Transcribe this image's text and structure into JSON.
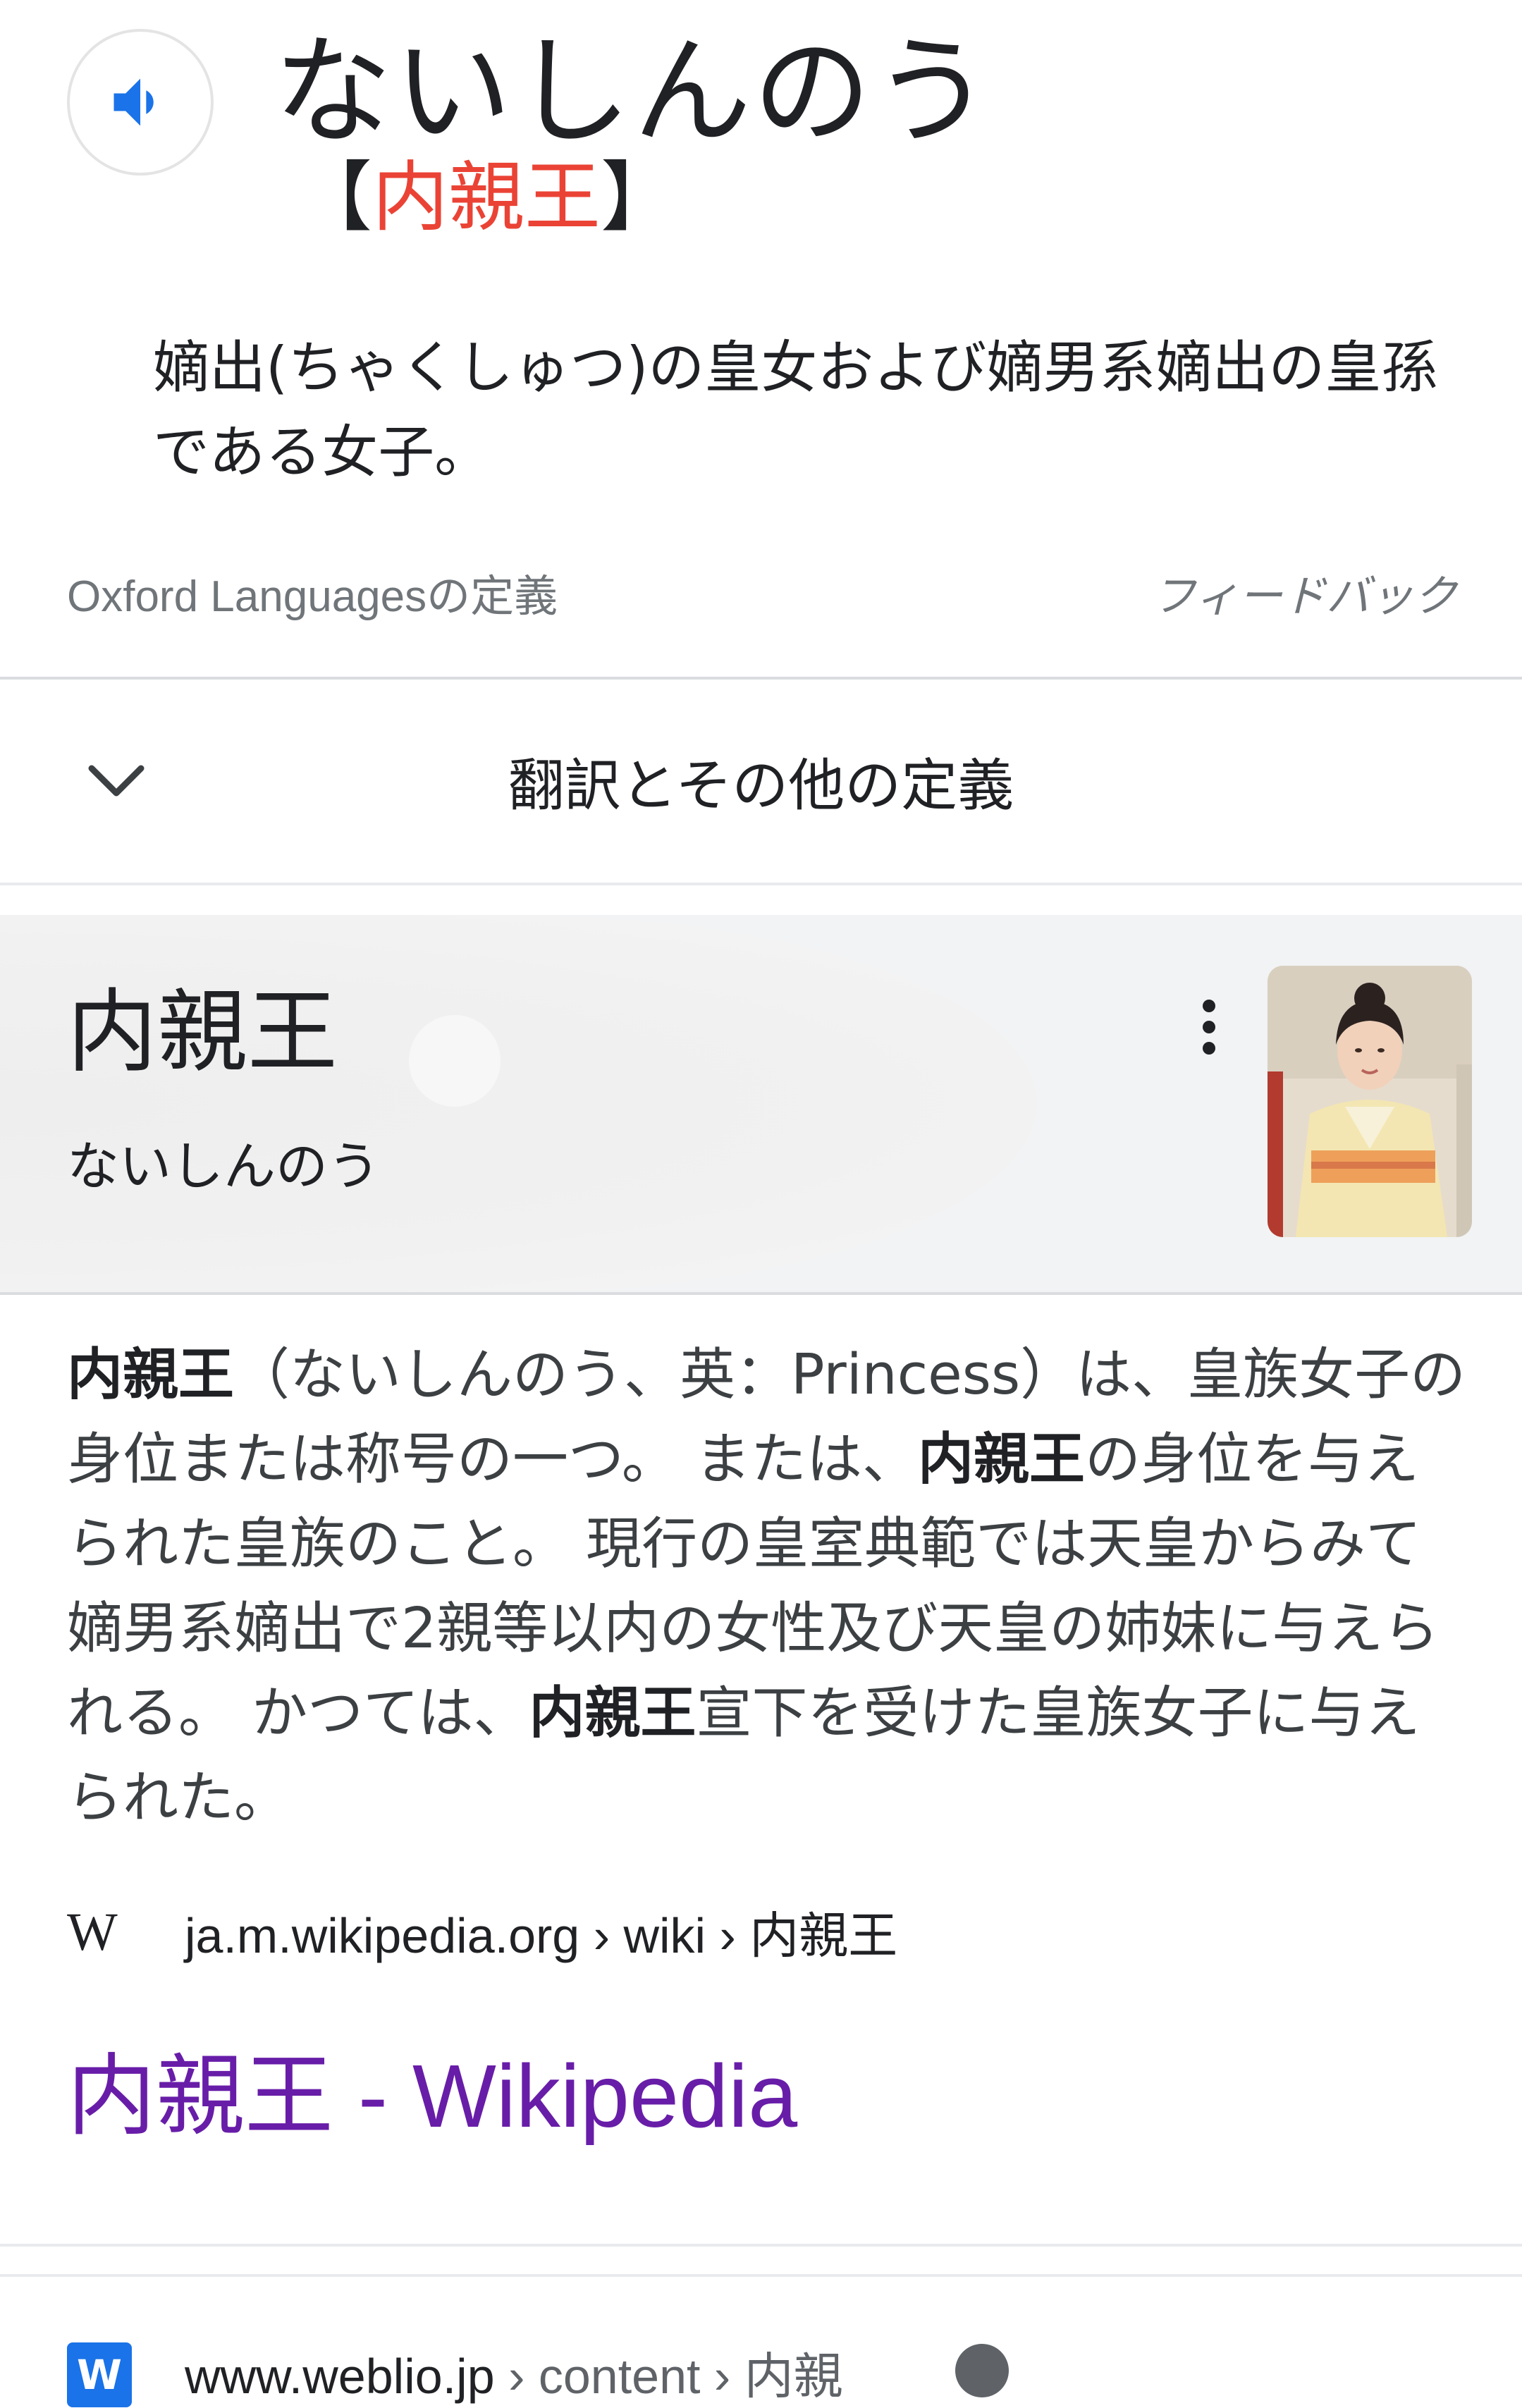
{
  "dictionary": {
    "headword": "ないしんのう",
    "kanji_open": "【",
    "kanji": "内親王",
    "kanji_close": "】",
    "definition": "嫡出(ちゃくしゅつ)の皇女および嫡男系嫡出の皇孫である女子。",
    "source": "Oxford Languagesの定義",
    "feedback": "フィードバック",
    "expand_label": "翻訳とその他の定義",
    "speaker_icon": "speaker-icon"
  },
  "knowledge_panel": {
    "title": "内親王",
    "subtitle": "ないしんのう",
    "photo_icon": "portrait-photo",
    "description": [
      {
        "b": "内親王"
      },
      {
        "t": "（ないしんのう、英：Princess）は、皇族女子の身位または称号の一つ。 または、"
      },
      {
        "b": "内親王"
      },
      {
        "t": "の身位を与えられた皇族のこと。 現行の皇室典範では天皇からみて嫡男系嫡出で2親等以内の女性及び天皇の姉妹に与えられる。 かつては、"
      },
      {
        "b": "内親王"
      },
      {
        "t": "宣下を受けた皇族女子に与えられた。"
      }
    ],
    "source_logo": "W",
    "source_url": "ja.m.wikipedia.org › wiki › 内親王",
    "link_title": "内親王 - Wikipedia"
  },
  "next_result": {
    "favicon_letter": "W",
    "domain": "www.weblio.jp",
    "crumbs": " › content › 内親",
    "amp_icon": "amp-lightning-icon"
  },
  "colors": {
    "accent_red": "#ea4335",
    "speaker_blue": "#1a73e8",
    "visited_link": "#681da8"
  }
}
